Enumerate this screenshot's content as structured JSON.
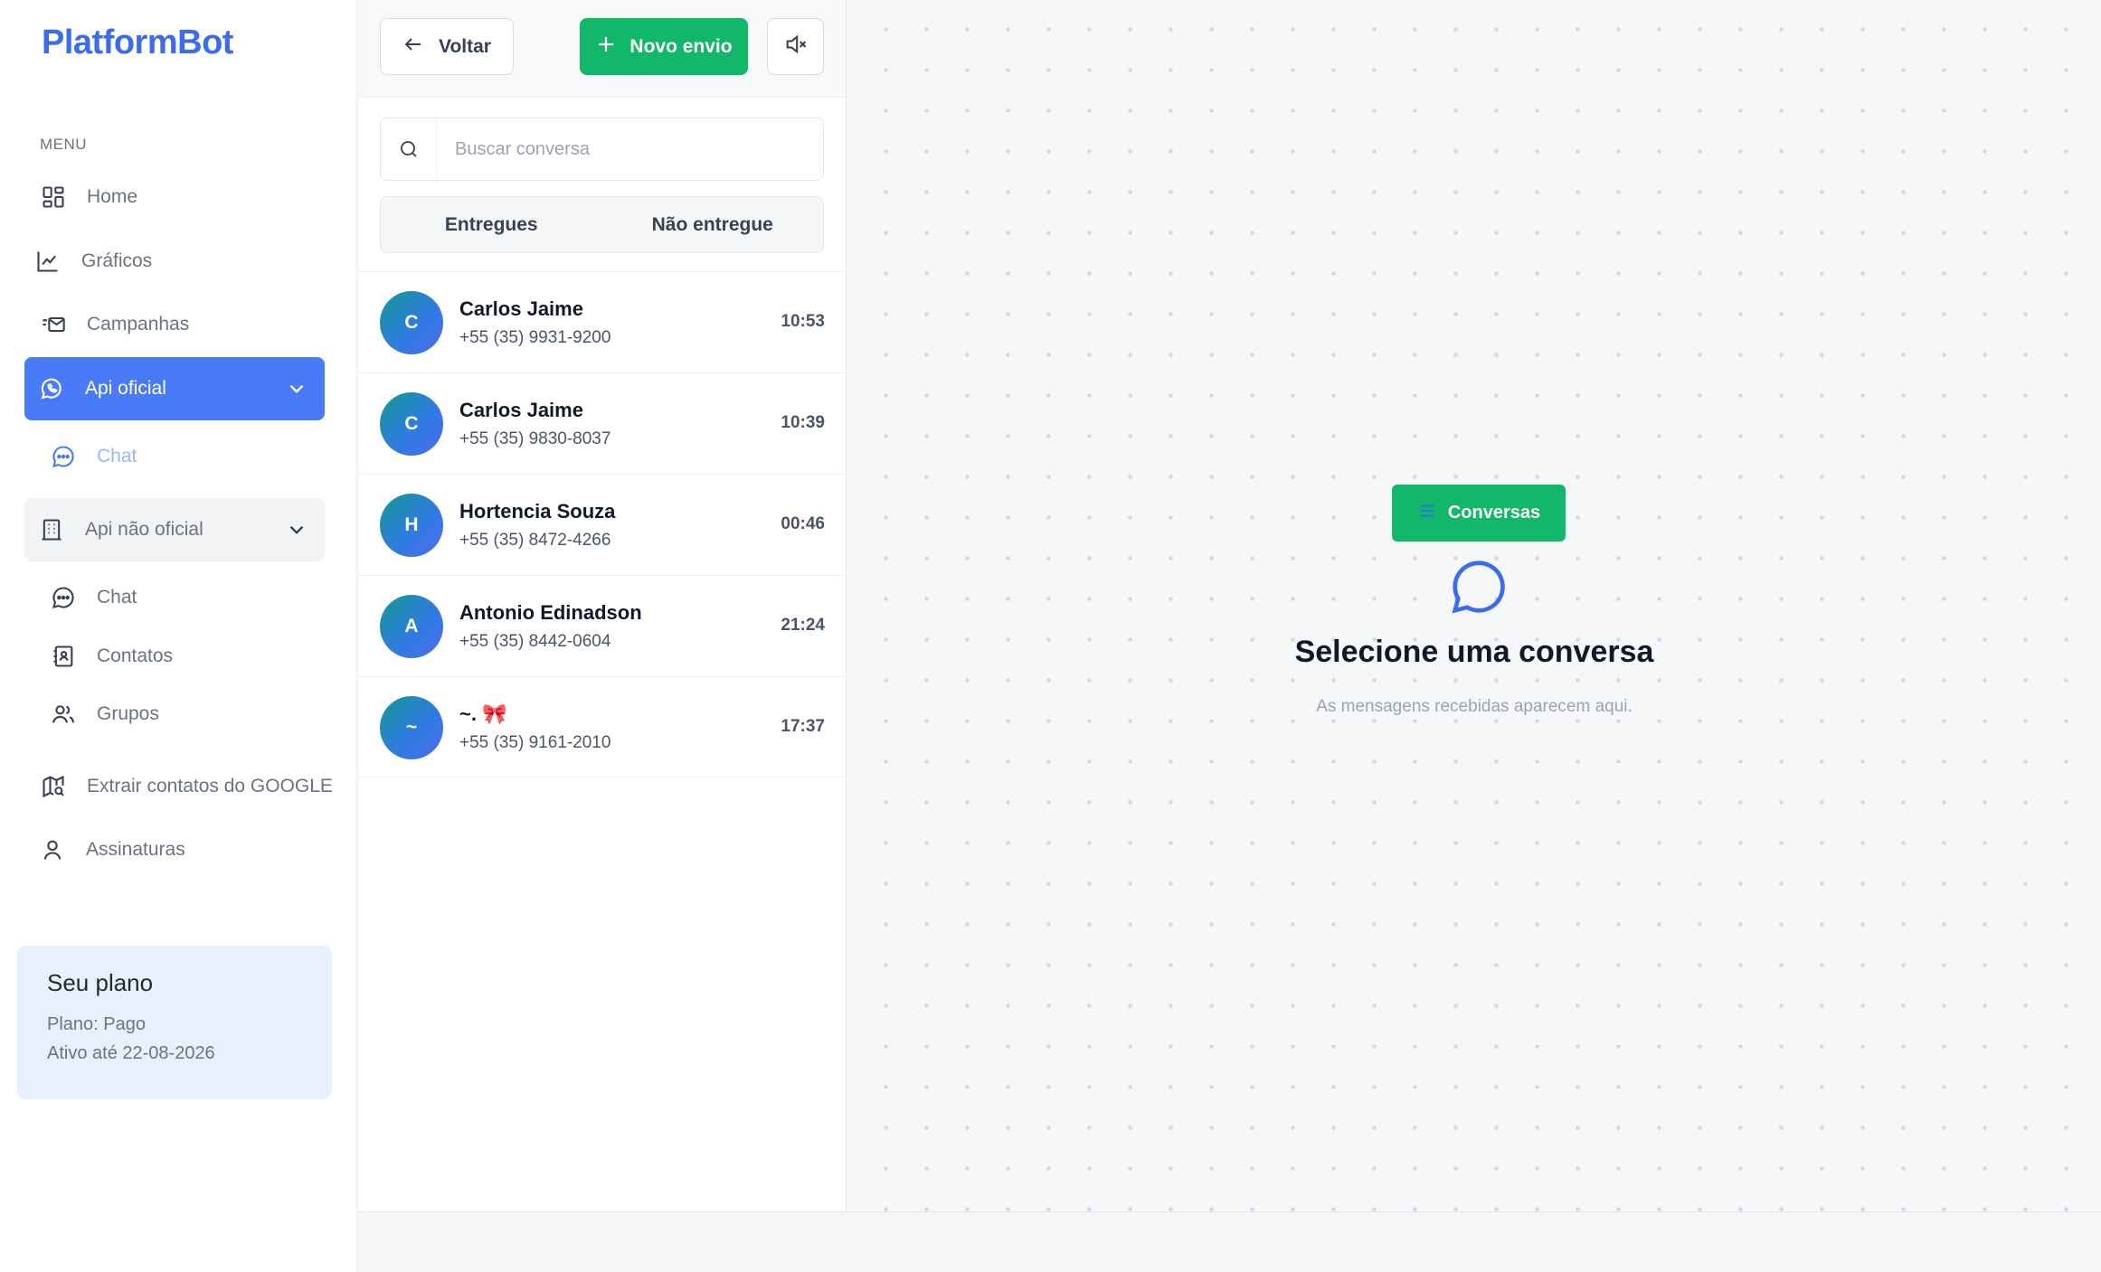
{
  "brand": {
    "logo": "PlatformBot",
    "accent": "#3b6cf0"
  },
  "sidebar": {
    "menu_label": "MENU",
    "items": [
      {
        "label": "Home",
        "icon": "grid-icon"
      },
      {
        "label": "Gráficos",
        "icon": "chart-line-icon"
      },
      {
        "label": "Campanhas",
        "icon": "mail-send-icon"
      }
    ],
    "api_oficial": {
      "label": "Api oficial",
      "icon": "whatsapp-icon",
      "sub": [
        {
          "label": "Chat",
          "icon": "chat-bubble-icon"
        }
      ]
    },
    "api_nao_oficial": {
      "label": "Api não oficial",
      "icon": "building-icon",
      "sub": [
        {
          "label": "Chat",
          "icon": "chat-bubble-icon"
        },
        {
          "label": "Contatos",
          "icon": "contacts-book-icon"
        },
        {
          "label": "Grupos",
          "icon": "users-icon"
        }
      ]
    },
    "extra": [
      {
        "label": "Extrair contatos do GOOGLE",
        "icon": "map-search-icon"
      },
      {
        "label": "Assinaturas",
        "icon": "user-icon"
      }
    ],
    "plan": {
      "title": "Seu plano",
      "line1": "Plano: Pago",
      "line2": "Ativo até 22-08-2026"
    }
  },
  "list": {
    "back_label": "Voltar",
    "new_label": "Novo envio",
    "search_placeholder": "Buscar conversa",
    "tabs": [
      "Entregues",
      "Não entregue"
    ],
    "conversations": [
      {
        "initial": "C",
        "name": "Carlos Jaime",
        "phone": "+55 (35) 9931-9200",
        "time": "10:53"
      },
      {
        "initial": "C",
        "name": "Carlos Jaime",
        "phone": "+55 (35) 9830-8037",
        "time": "10:39"
      },
      {
        "initial": "H",
        "name": "Hortencia Souza",
        "phone": "+55 (35) 8472-4266",
        "time": "00:46"
      },
      {
        "initial": "A",
        "name": "Antonio Edinadson",
        "phone": "+55 (35) 8442-0604",
        "time": "21:24"
      },
      {
        "initial": "~",
        "name": "~. 🎀",
        "phone": "+55 (35) 9161-2010",
        "time": "17:37"
      }
    ]
  },
  "main": {
    "conversas_label": "Conversas",
    "empty_title": "Selecione uma conversa",
    "empty_subtitle": "As mensagens recebidas aparecem aqui."
  },
  "colors": {
    "primary": "#4a7bf7",
    "success": "#12b76a"
  }
}
